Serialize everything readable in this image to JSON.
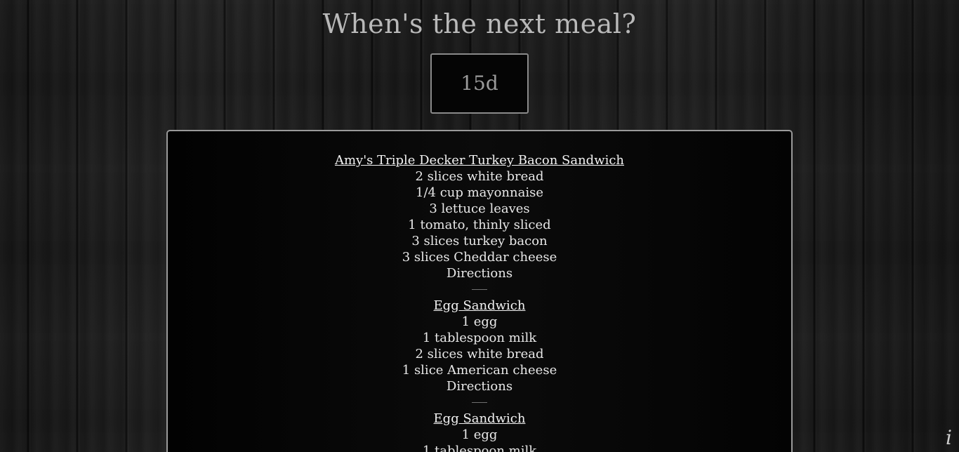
{
  "header": {
    "title": "When's the next meal?"
  },
  "countdown": {
    "value": "15d"
  },
  "recipes": [
    {
      "title": "Amy's Triple Decker Turkey Bacon Sandwich",
      "lines": [
        "2 slices white bread",
        "1/4 cup mayonnaise",
        "3 lettuce leaves",
        "1 tomato, thinly sliced",
        "3 slices turkey bacon",
        "3 slices Cheddar cheese",
        "Directions"
      ]
    },
    {
      "title": "Egg Sandwich",
      "lines": [
        "1 egg",
        "1 tablespoon milk",
        "2 slices white bread",
        "1 slice American cheese",
        "Directions"
      ]
    },
    {
      "title": "Egg Sandwich",
      "lines": [
        "1 egg",
        "1 tablespoon milk"
      ]
    }
  ],
  "info": {
    "label": "i"
  }
}
